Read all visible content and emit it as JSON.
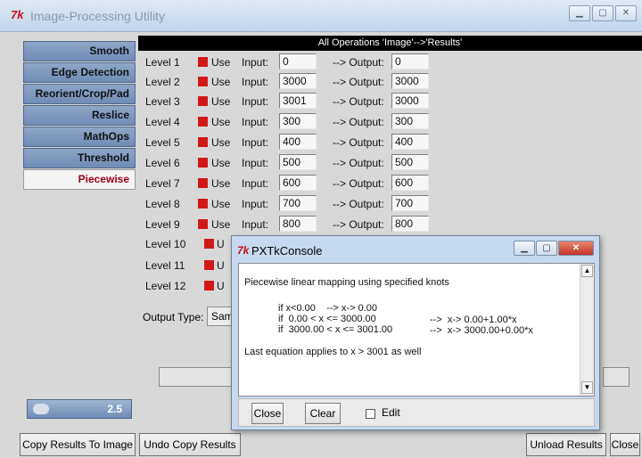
{
  "window": {
    "title": "Image-Processing Utility",
    "controls": [
      "minimize",
      "maximize",
      "close"
    ],
    "accent": "#c0101a"
  },
  "tabs": [
    {
      "label": "Smooth",
      "active": false
    },
    {
      "label": "Edge Detection",
      "active": false
    },
    {
      "label": "Reorient/Crop/Pad",
      "active": false
    },
    {
      "label": "Reslice",
      "active": false
    },
    {
      "label": "MathOps",
      "active": false
    },
    {
      "label": "Threshold",
      "active": false
    },
    {
      "label": "Piecewise",
      "active": true
    }
  ],
  "zoom": {
    "value": "2.5"
  },
  "panel": {
    "header": "All Operations 'Image'-->'Results'",
    "use_label": "Use",
    "input_label": "Input:",
    "output_label": "--> Output:",
    "levels": [
      {
        "label": "Level 1",
        "use": true,
        "input": "0",
        "output": "0"
      },
      {
        "label": "Level 2",
        "use": true,
        "input": "3000",
        "output": "3000"
      },
      {
        "label": "Level 3",
        "use": true,
        "input": "3001",
        "output": "3000"
      },
      {
        "label": "Level 4",
        "use": false,
        "input": "300",
        "output": "300"
      },
      {
        "label": "Level 5",
        "use": false,
        "input": "400",
        "output": "400"
      },
      {
        "label": "Level 6",
        "use": false,
        "input": "500",
        "output": "500"
      },
      {
        "label": "Level 7",
        "use": false,
        "input": "600",
        "output": "600"
      },
      {
        "label": "Level 8",
        "use": false,
        "input": "700",
        "output": "700"
      },
      {
        "label": "Level 9",
        "use": false,
        "input": "800",
        "output": "800"
      },
      {
        "label": "Level 10"
      },
      {
        "label": "Level 11"
      },
      {
        "label": "Level 12"
      }
    ],
    "output_type_label": "Output Type:",
    "output_type_value": "Sam"
  },
  "bottom_buttons": {
    "copy_results": "Copy Results To Image",
    "undo_copy": "Undo Copy Results",
    "unload_results": "Unload Results",
    "close": "Close"
  },
  "console": {
    "title": "PXTkConsole",
    "lines": [
      "Piecewise linear mapping using specified knots",
      "if x<0.00    --> x-> 0.00",
      "if  0.00 < x <= 3000.00",
      "-->  x-> 0.00+1.00*x",
      "if  3000.00 < x <= 3001.00",
      "-->  x-> 3000.00+0.00*x",
      "Last equation applies to x > 3001 as well"
    ],
    "close_btn": "Close",
    "clear_btn": "Clear",
    "edit_label": "Edit",
    "edit_checked": false
  }
}
